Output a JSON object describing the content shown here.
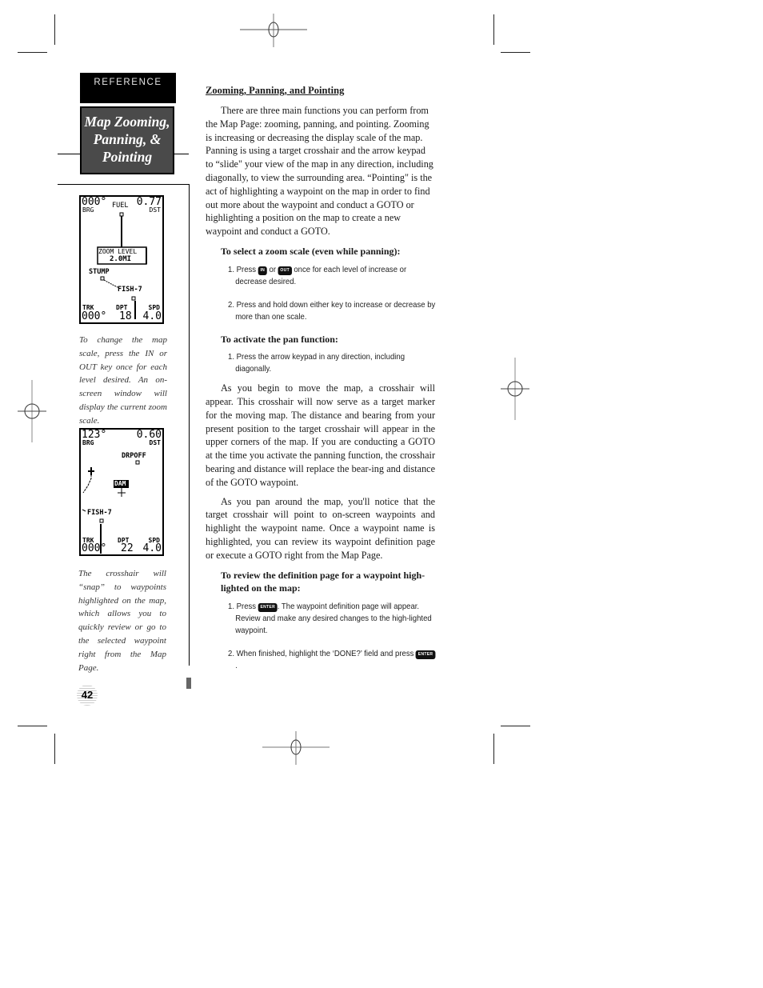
{
  "section_tab": "REFERENCE",
  "sidebar_title": "Map Zooming, Panning, & Pointing",
  "sidebar_title_lines": [
    "Map Zooming,",
    "Panning, &",
    "Pointing"
  ],
  "screen1": {
    "brg_value": "000°",
    "brg_label": "BRG",
    "dst_value": "0.77",
    "dst_label": "DST",
    "waypoint_top": "FUEL",
    "zoom_window_title": "ZOOM LEVEL",
    "zoom_window_value": "2.0MI",
    "waypoint_a": "STUMP",
    "waypoint_b": "FISH-7",
    "trk_label": "TRK",
    "trk_value": "000°",
    "dpt_label": "DPT",
    "dpt_value": "18",
    "spd_label": "SPD",
    "spd_value": "4.0"
  },
  "caption1": "To change the map scale, press the IN or OUT key once for each level desired. An on-screen window will display the current zoom scale.",
  "screen2": {
    "brg_value": "123°",
    "brg_label": "BRG",
    "dst_value": "0.60",
    "dst_label": "DST",
    "waypoint_top": "DRPOFF",
    "highlighted_waypoint": "DAM",
    "waypoint_b": "FISH-7",
    "trk_label": "TRK",
    "trk_value": "000°",
    "dpt_label": "DPT",
    "dpt_value": "22",
    "spd_label": "SPD",
    "spd_value": "4.0"
  },
  "caption2": "The crosshair will “snap” to waypoints highlighted on the map, which allows you to quickly review or go to the selected waypoint right from the Map Page.",
  "page_number": "42",
  "main": {
    "heading": "Zooming, Panning, and Pointing",
    "intro": "There are three main functions you can perform from the Map Page: zooming, panning, and pointing. Zooming is increasing or decreasing the display scale of the map. Panning is using a target crosshair and the arrow keypad to “slide\" your view of the map in any direction, including diagonally, to view the surrounding area. “Pointing\" is the act of highlighting a waypoint on the map in order to find out more about the waypoint and conduct a GOTO or highlighting a position on the map to create a new waypoint and conduct a GOTO.",
    "zoom_heading": "To select a zoom scale (even while panning):",
    "zoom_step1_a": "1. Press ",
    "key_in": "IN",
    "zoom_step1_or": " or ",
    "key_out": "OUT",
    "zoom_step1_b": " once for each level of increase or decrease desired.",
    "zoom_step2": "2. Press and hold down either key to increase or decrease by more than one scale.",
    "pan_heading": "To activate the pan function:",
    "pan_step1": "1. Press the arrow keypad in any direction, including diagonally.",
    "para2": "As you begin to move the map, a crosshair will appear. This crosshair will now serve as a target marker for the moving map. The distance and bearing from your present position to the target crosshair will appear in the upper corners of the map. If you are conducting a GOTO at the time you activate the panning function, the crosshair bearing and distance will replace the bear-ing and distance of the GOTO waypoint.",
    "para3": "As you pan around the map, you'll notice that the target crosshair will point to on-screen waypoints and highlight the waypoint name. Once a waypoint name is highlighted, you can review its waypoint definition page or execute a GOTO right from the Map Page.",
    "review_heading": "To review the definition page for a waypoint high-lighted on the map:",
    "review_step1_a": "1. Press ",
    "key_enter": "ENTER",
    "review_step1_b": ". The waypoint definition page will appear. Review and make any desired changes to the high-lighted waypoint.",
    "review_step2_a": "2. When finished, highlight the ‘DONE?’ field and press ",
    "review_step2_b": "."
  }
}
